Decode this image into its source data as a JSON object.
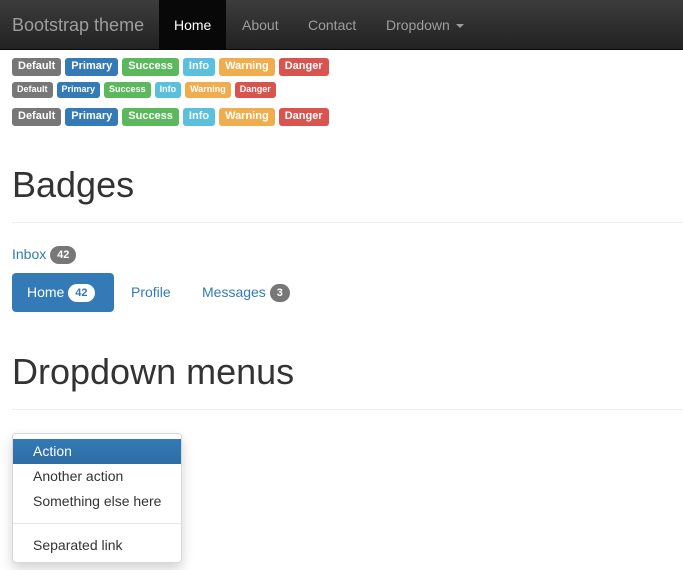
{
  "navbar": {
    "brand": "Bootstrap theme",
    "items": [
      {
        "label": "Home",
        "active": true
      },
      {
        "label": "About"
      },
      {
        "label": "Contact"
      },
      {
        "label": "Dropdown",
        "has_caret": true
      }
    ]
  },
  "labels": {
    "rows": [
      [
        "Default",
        "Primary",
        "Success",
        "Info",
        "Warning",
        "Danger"
      ],
      [
        "Default",
        "Primary",
        "Success",
        "Info",
        "Warning",
        "Danger"
      ],
      [
        "Default",
        "Primary",
        "Success",
        "Info",
        "Warning",
        "Danger"
      ]
    ],
    "colors": {
      "default": "#777777",
      "primary": "#337ab7",
      "success": "#5cb85c",
      "info": "#5bc0de",
      "warning": "#f0ad4e",
      "danger": "#d9534f"
    }
  },
  "badges_section": {
    "title": "Badges",
    "inbox": {
      "label": "Inbox",
      "count": "42"
    },
    "pills": [
      {
        "label": "Home",
        "count": "42",
        "active": true
      },
      {
        "label": "Profile"
      },
      {
        "label": "Messages",
        "count": "3"
      }
    ]
  },
  "dropdown_section": {
    "title": "Dropdown menus",
    "items": [
      {
        "label": "Action",
        "active": true
      },
      {
        "label": "Another action"
      },
      {
        "label": "Something else here"
      },
      {
        "label": "Separated link"
      }
    ]
  }
}
